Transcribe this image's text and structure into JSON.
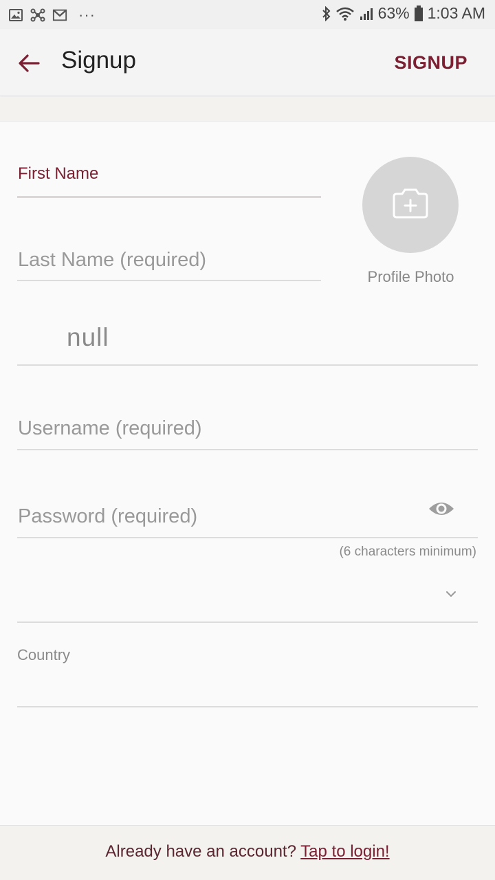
{
  "status_bar": {
    "battery": "63%",
    "time": "1:03 AM",
    "more": "···"
  },
  "app_bar": {
    "title": "Signup",
    "action_label": "SIGNUP"
  },
  "form": {
    "first_name": {
      "label": "First Name"
    },
    "last_name": {
      "placeholder": "Last Name (required)"
    },
    "unnamed_field": {
      "value": "null"
    },
    "username": {
      "placeholder": "Username (required)"
    },
    "password": {
      "placeholder": "Password (required)",
      "hint": "(6 characters minimum)"
    },
    "country": {
      "label": "Country"
    }
  },
  "profile_photo": {
    "label": "Profile Photo"
  },
  "footer": {
    "prompt": "Already have an account? ",
    "link": "Tap to login!"
  },
  "colors": {
    "accent": "#7a2032",
    "placeholder": "#999999",
    "divider": "#dcdcdc"
  }
}
